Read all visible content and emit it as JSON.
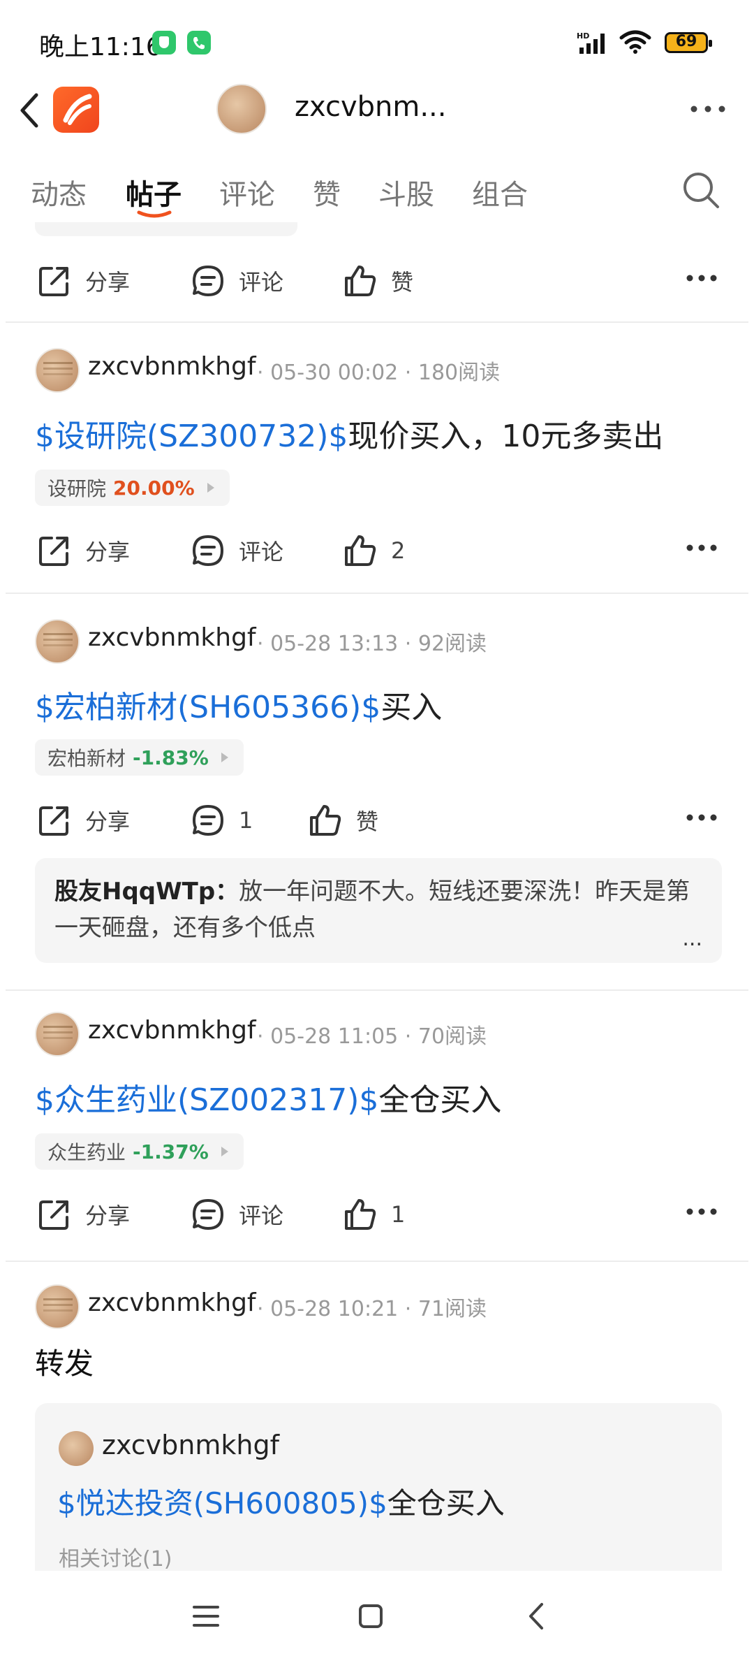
{
  "status_bar": {
    "time": "晚上11:16",
    "network": "HD",
    "battery": "69",
    "icons": [
      "shield-icon",
      "phone-icon",
      "signal-icon",
      "wifi-icon",
      "battery-icon"
    ]
  },
  "header": {
    "username": "zxcvbnm...",
    "icons": [
      "back-icon",
      "app-logo",
      "more-icon"
    ]
  },
  "tabs": [
    {
      "label": "动态"
    },
    {
      "label": "帖子"
    },
    {
      "label": "评论"
    },
    {
      "label": "赞"
    },
    {
      "label": "斗股"
    },
    {
      "label": "组合"
    }
  ],
  "active_tab": "帖子",
  "actions": {
    "share": "分享",
    "comment": "评论",
    "like": "赞"
  },
  "top_actions": {
    "share": "分享",
    "comment": "评论",
    "like": "赞"
  },
  "posts": [
    {
      "user": "zxcvbnmkhgf",
      "time": "05-30 00:02",
      "reads": "180阅读",
      "stock": "$设研院(SZ300732)$",
      "text": "现价买入，10元多卖出",
      "tag_name": "设研院",
      "tag_pct": "20.00%",
      "share": "分享",
      "comment": "评论",
      "like": "2"
    },
    {
      "user": "zxcvbnmkhgf",
      "time": "05-28 13:13",
      "reads": "92阅读",
      "stock": "$宏柏新材(SH605366)$",
      "text": "买入",
      "tag_name": "宏柏新材",
      "tag_pct": "-1.83%",
      "share": "分享",
      "comment": "1",
      "like": "赞",
      "reply_user": "股友HqqWTp：",
      "reply_text": "放一年问题不大。短线还要深洗！昨天是第一天砸盘，还有多个低点",
      "reply_more": "..."
    },
    {
      "user": "zxcvbnmkhgf",
      "time": "05-28 11:05",
      "reads": "70阅读",
      "stock": "$众生药业(SZ002317)$",
      "text": "全仓买入",
      "tag_name": "众生药业",
      "tag_pct": "-1.37%",
      "share": "分享",
      "comment": "评论",
      "like": "1"
    },
    {
      "user": "zxcvbnmkhgf",
      "time": "05-28 10:21",
      "reads": "71阅读",
      "text": "转发",
      "quoted": {
        "user": "zxcvbnmkhgf",
        "stock": "$悦达投资(SH600805)$",
        "text": "全仓买入",
        "related": "相关讨论(1)"
      }
    }
  ],
  "colors": {
    "stock_link": "#1a6ed8",
    "up": "#e0501e",
    "down": "#2fa05a",
    "accent_underline": "#f0521e"
  },
  "nav": [
    "menu-icon",
    "home-icon",
    "back-icon"
  ]
}
